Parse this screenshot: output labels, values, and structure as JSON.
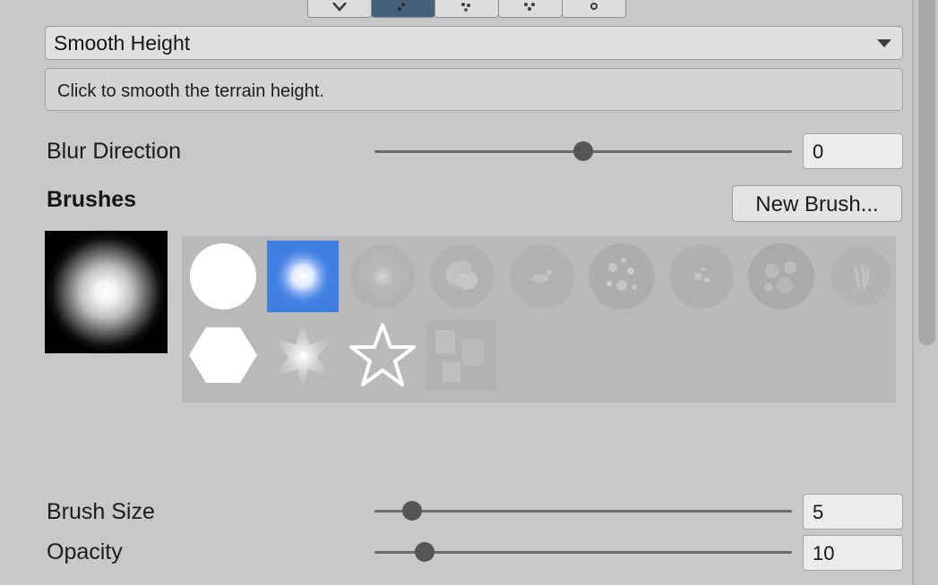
{
  "toolbar": {
    "tools": [
      {
        "icon": "raise-lower-icon",
        "active": false
      },
      {
        "icon": "paint-texture-icon",
        "active": true
      },
      {
        "icon": "stamp-icon",
        "active": false
      },
      {
        "icon": "set-height-icon",
        "active": false
      },
      {
        "icon": "settings-icon",
        "active": false
      }
    ]
  },
  "tool_select": {
    "value": "Smooth Height"
  },
  "help": {
    "text": "Click to smooth the terrain height."
  },
  "blur_direction": {
    "label": "Blur Direction",
    "value": "0",
    "fraction": 0.5
  },
  "brushes": {
    "heading": "Brushes",
    "new_brush_label": "New Brush...",
    "selected_index": 1,
    "items": [
      {
        "name": "hard-circle-brush-icon"
      },
      {
        "name": "soft-circle-brush-icon"
      },
      {
        "name": "faded-dot-brush-icon"
      },
      {
        "name": "cloudy-brush-icon"
      },
      {
        "name": "smudge-brush-icon"
      },
      {
        "name": "speckled-brush-icon"
      },
      {
        "name": "spotted-brush-icon"
      },
      {
        "name": "noise-brush-icon"
      },
      {
        "name": "streak-brush-icon"
      },
      {
        "name": "hexagon-brush-icon"
      },
      {
        "name": "starburst-brush-icon"
      },
      {
        "name": "star-outline-brush-icon"
      },
      {
        "name": "texture-brush-icon"
      }
    ]
  },
  "brush_size": {
    "label": "Brush Size",
    "value": "5",
    "fraction": 0.09
  },
  "opacity": {
    "label": "Opacity",
    "value": "10",
    "fraction": 0.12
  },
  "colors": {
    "selection": "#3f7ee3",
    "panel": "#c8c8c8"
  }
}
